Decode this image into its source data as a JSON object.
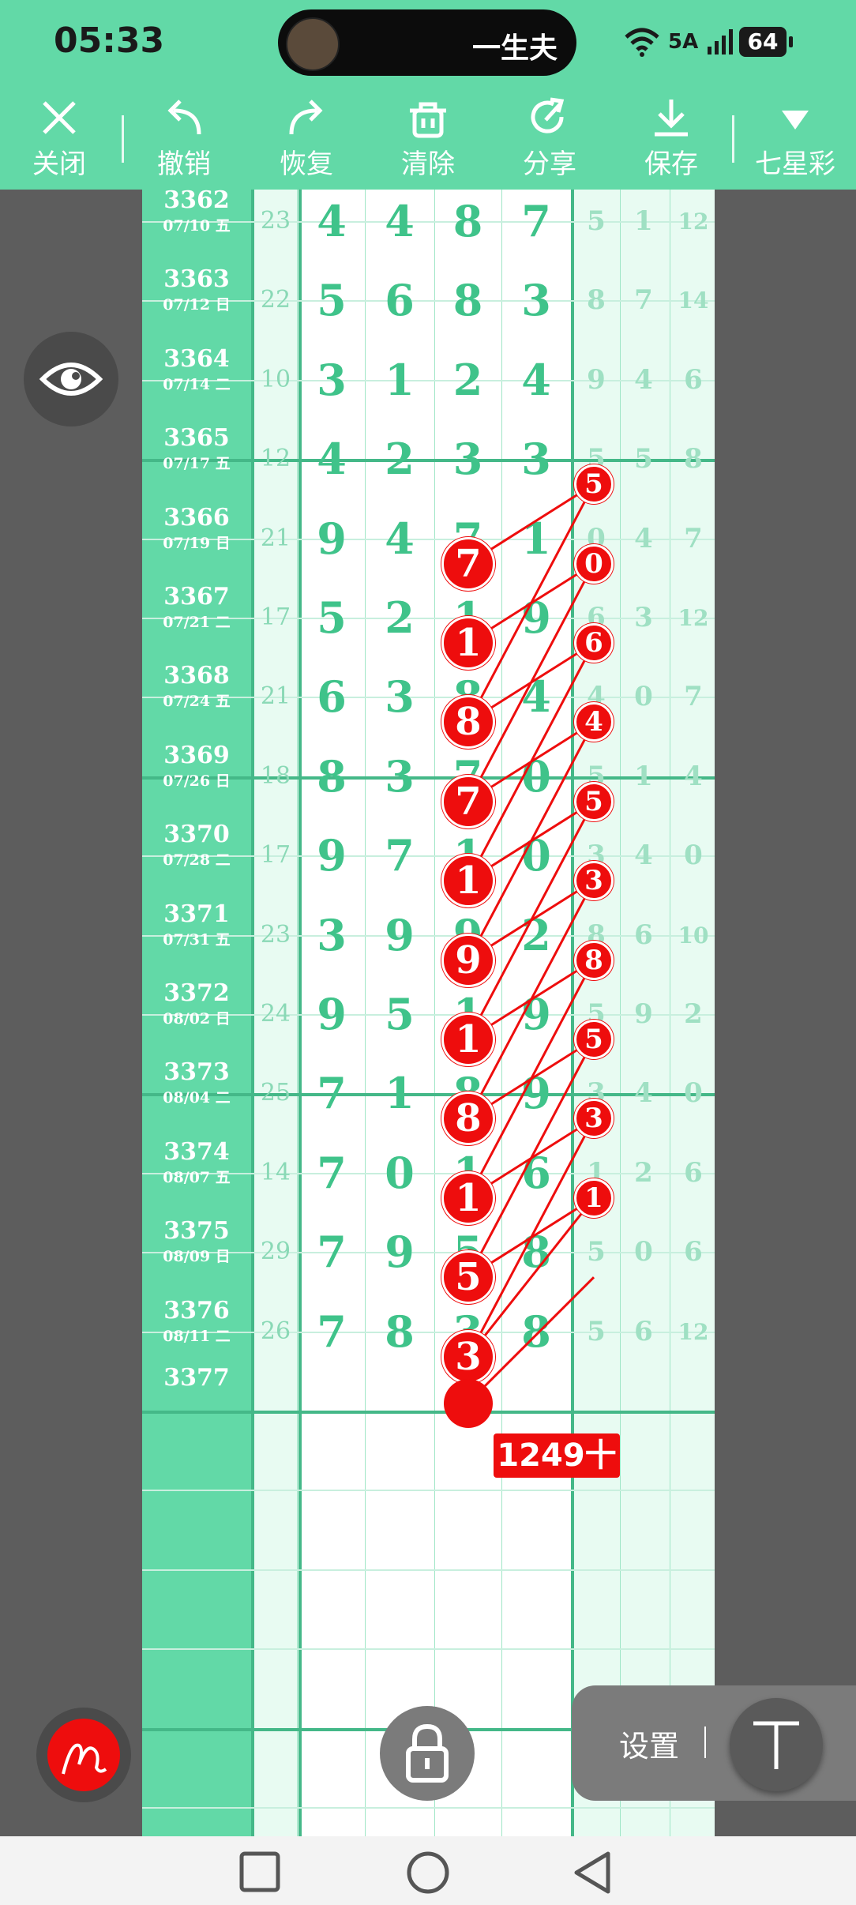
{
  "status_bar": {
    "time": "05:33",
    "island_text": "一生夫",
    "network_label": "5A",
    "battery": "64"
  },
  "toolbar": {
    "close": "关闭",
    "undo": "撤销",
    "redo": "恢复",
    "clear": "清除",
    "share": "分享",
    "save": "保存",
    "lottery": "七星彩"
  },
  "rows": [
    {
      "issue": "3362",
      "date": "07/10 五",
      "sum": "23",
      "d": [
        "4",
        "4",
        "8",
        "7"
      ],
      "r": [
        "5",
        "1",
        "12"
      ]
    },
    {
      "issue": "3363",
      "date": "07/12 日",
      "sum": "22",
      "d": [
        "5",
        "6",
        "8",
        "3"
      ],
      "r": [
        "8",
        "7",
        "14"
      ]
    },
    {
      "issue": "3364",
      "date": "07/14 二",
      "sum": "10",
      "d": [
        "3",
        "1",
        "2",
        "4"
      ],
      "r": [
        "9",
        "4",
        "6"
      ]
    },
    {
      "issue": "3365",
      "date": "07/17 五",
      "sum": "12",
      "d": [
        "4",
        "2",
        "3",
        "3"
      ],
      "r": [
        "5",
        "5",
        "8"
      ]
    },
    {
      "issue": "3366",
      "date": "07/19 日",
      "sum": "21",
      "d": [
        "9",
        "4",
        "7",
        "1"
      ],
      "r": [
        "0",
        "4",
        "7"
      ]
    },
    {
      "issue": "3367",
      "date": "07/21 二",
      "sum": "17",
      "d": [
        "5",
        "2",
        "1",
        "9"
      ],
      "r": [
        "6",
        "3",
        "12"
      ]
    },
    {
      "issue": "3368",
      "date": "07/24 五",
      "sum": "21",
      "d": [
        "6",
        "3",
        "8",
        "4"
      ],
      "r": [
        "4",
        "0",
        "7"
      ]
    },
    {
      "issue": "3369",
      "date": "07/26 日",
      "sum": "18",
      "d": [
        "8",
        "3",
        "7",
        "0"
      ],
      "r": [
        "5",
        "1",
        "4"
      ]
    },
    {
      "issue": "3370",
      "date": "07/28 二",
      "sum": "17",
      "d": [
        "9",
        "7",
        "1",
        "0"
      ],
      "r": [
        "3",
        "4",
        "0"
      ]
    },
    {
      "issue": "3371",
      "date": "07/31 五",
      "sum": "23",
      "d": [
        "3",
        "9",
        "9",
        "2"
      ],
      "r": [
        "8",
        "6",
        "10"
      ]
    },
    {
      "issue": "3372",
      "date": "08/02 日",
      "sum": "24",
      "d": [
        "9",
        "5",
        "1",
        "9"
      ],
      "r": [
        "5",
        "9",
        "2"
      ]
    },
    {
      "issue": "3373",
      "date": "08/04 二",
      "sum": "25",
      "d": [
        "7",
        "1",
        "8",
        "9"
      ],
      "r": [
        "3",
        "4",
        "0"
      ]
    },
    {
      "issue": "3374",
      "date": "08/07 五",
      "sum": "14",
      "d": [
        "7",
        "0",
        "1",
        "6"
      ],
      "r": [
        "1",
        "2",
        "6"
      ]
    },
    {
      "issue": "3375",
      "date": "08/09 日",
      "sum": "29",
      "d": [
        "7",
        "9",
        "5",
        "8"
      ],
      "r": [
        "5",
        "0",
        "6"
      ]
    },
    {
      "issue": "3376",
      "date": "08/11 二",
      "sum": "26",
      "d": [
        "7",
        "8",
        "3",
        "8"
      ],
      "r": [
        "5",
        "6",
        "12"
      ]
    }
  ],
  "next_issue": "3377",
  "prediction_tag": "1249十",
  "settings_label": "设置",
  "colors": {
    "accent_green": "#62d9a7",
    "mark_red": "#ee0d0d",
    "digit_green": "#3fc38a"
  },
  "icons": [
    "close-icon",
    "undo-icon",
    "redo-icon",
    "trash-icon",
    "share-icon",
    "download-icon",
    "triangle-down-icon",
    "eye-icon",
    "pen-icon",
    "lock-icon",
    "text-icon"
  ]
}
